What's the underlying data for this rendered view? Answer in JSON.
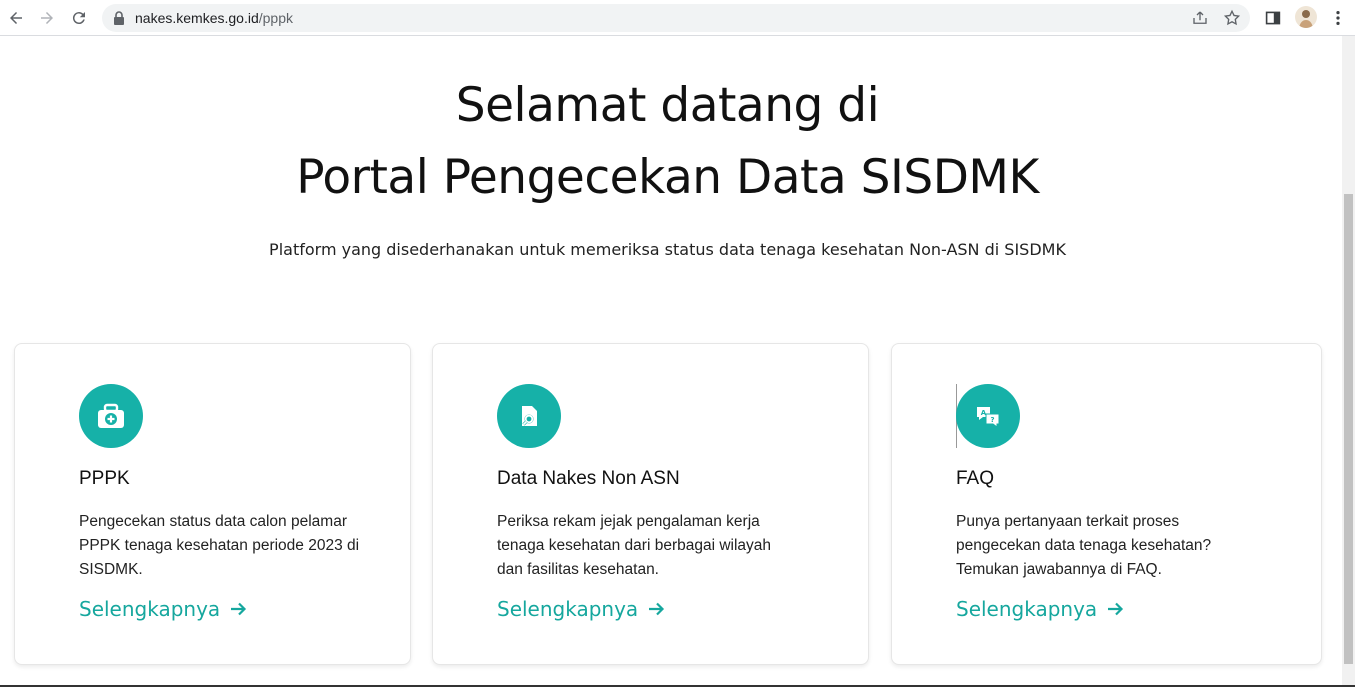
{
  "browser": {
    "url_host": "nakes.kemkes.go.id",
    "url_path": "/pppk"
  },
  "hero": {
    "title_line1": "Selamat datang di",
    "title_line2": "Portal Pengecekan Data SISDMK",
    "subtitle": "Platform yang disederhanakan untuk memeriksa status data tenaga kesehatan Non-ASN di SISDMK"
  },
  "cards": [
    {
      "icon": "medical-kit-icon",
      "title": "PPPK",
      "description": "Pengecekan status data calon pelamar PPPK tenaga kesehatan periode 2023 di SISDMK.",
      "link": "Selengkapnya"
    },
    {
      "icon": "document-search-icon",
      "title": "Data Nakes Non ASN",
      "description": "Periksa rekam jejak pengalaman kerja tenaga kesehatan dari berbagai wilayah dan fasilitas kesehatan.",
      "link": "Selengkapnya"
    },
    {
      "icon": "question-chat-icon",
      "title": "FAQ",
      "description": "Punya pertanyaan terkait proses pengecekan data tenaga kesehatan? Temukan jawabannya di FAQ.",
      "link": "Selengkapnya"
    }
  ],
  "colors": {
    "accent": "#16b1a8",
    "link": "#16a79e"
  }
}
